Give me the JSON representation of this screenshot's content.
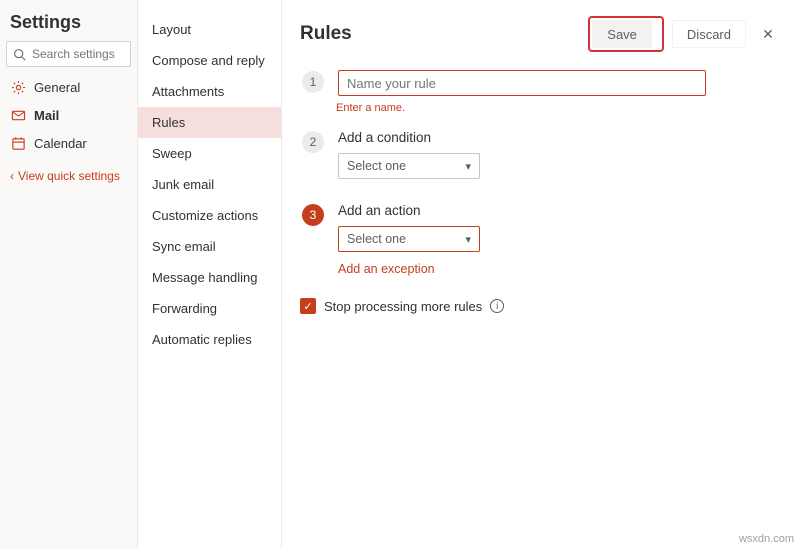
{
  "colors": {
    "accent": "#c43e1c"
  },
  "leftPanel": {
    "title": "Settings",
    "search_placeholder": "Search settings",
    "items": [
      {
        "label": "General"
      },
      {
        "label": "Mail"
      },
      {
        "label": "Calendar"
      }
    ],
    "quick_link": "View quick settings"
  },
  "midPanel": {
    "items": [
      {
        "label": "Layout"
      },
      {
        "label": "Compose and reply"
      },
      {
        "label": "Attachments"
      },
      {
        "label": "Rules"
      },
      {
        "label": "Sweep"
      },
      {
        "label": "Junk email"
      },
      {
        "label": "Customize actions"
      },
      {
        "label": "Sync email"
      },
      {
        "label": "Message handling"
      },
      {
        "label": "Forwarding"
      },
      {
        "label": "Automatic replies"
      }
    ]
  },
  "rightPanel": {
    "title": "Rules",
    "save_label": "Save",
    "discard_label": "Discard",
    "steps": {
      "s1_badge": "1",
      "s1_placeholder": "Name your rule",
      "s1_error": "Enter a name.",
      "s2_badge": "2",
      "s2_title": "Add a condition",
      "s2_select": "Select one",
      "s3_badge": "3",
      "s3_title": "Add an action",
      "s3_select": "Select one",
      "s3_link": "Add an exception"
    },
    "checkbox_label": "Stop processing more rules"
  },
  "watermark": "wsxdn.com"
}
